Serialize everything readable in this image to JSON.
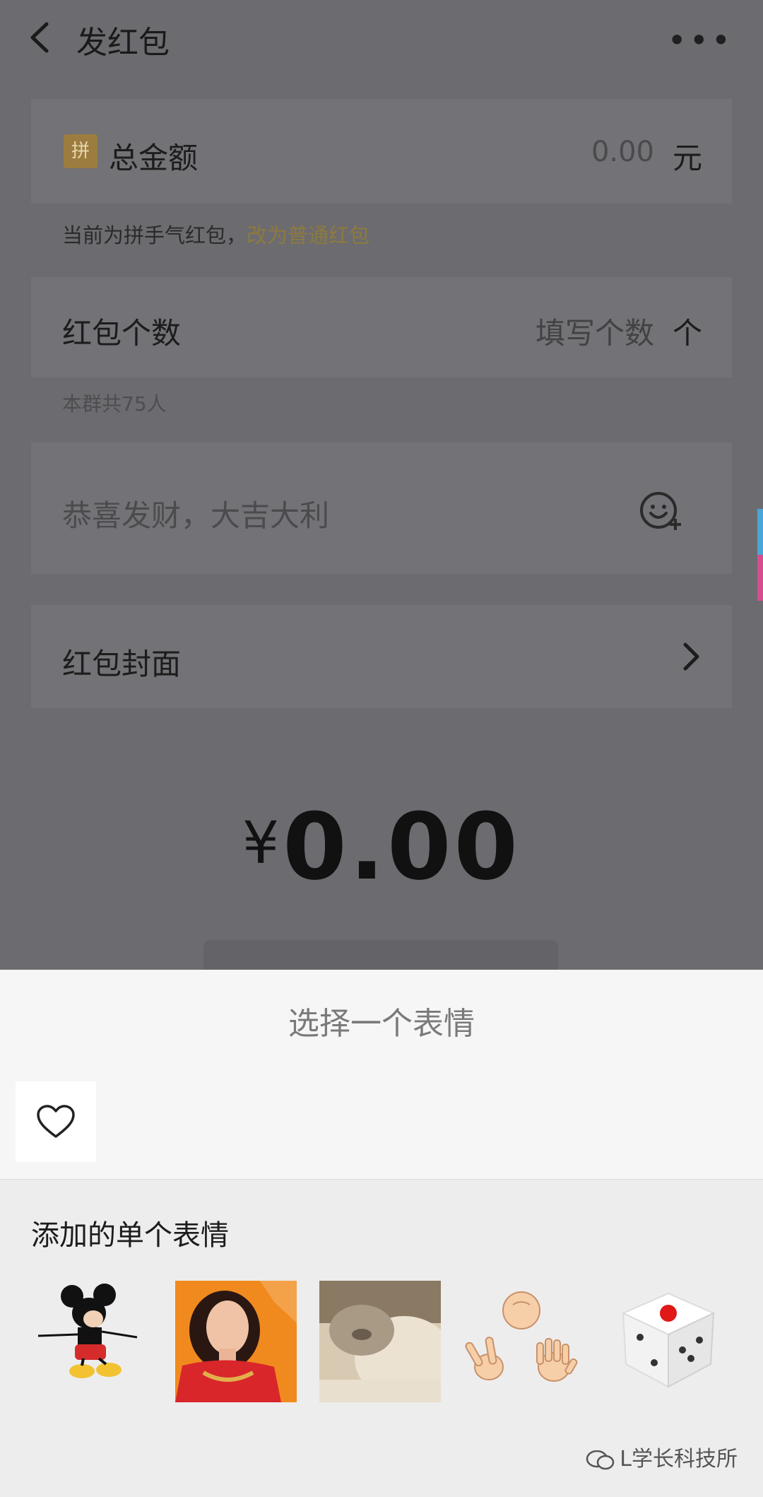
{
  "header": {
    "title": "发红包",
    "more": "•••"
  },
  "total": {
    "badge": "拼",
    "label": "总金额",
    "amount": "0.00",
    "unit": "元"
  },
  "hint1": {
    "prefix": "当前为拼手气红包，",
    "link": "改为普通红包"
  },
  "count": {
    "label": "红包个数",
    "placeholder": "填写个数",
    "unit": "个"
  },
  "hint2": "本群共75人",
  "wish": {
    "placeholder": "恭喜发财，大吉大利"
  },
  "cover": {
    "label": "红包封面"
  },
  "total_display": {
    "currency": "¥",
    "value": "0.00"
  },
  "sheet": {
    "title": "选择一个表情",
    "section_title": "添加的单个表情",
    "stickers": [
      "mickey-mouse-sticker",
      "woman-portrait-sticker",
      "cat-photo-sticker",
      "rock-paper-scissors-sticker",
      "dice-sticker"
    ]
  },
  "watermark": "L学长科技所",
  "colors": {
    "accent_gold": "#8d7a3f",
    "badge_gold": "#9d7d3f"
  }
}
